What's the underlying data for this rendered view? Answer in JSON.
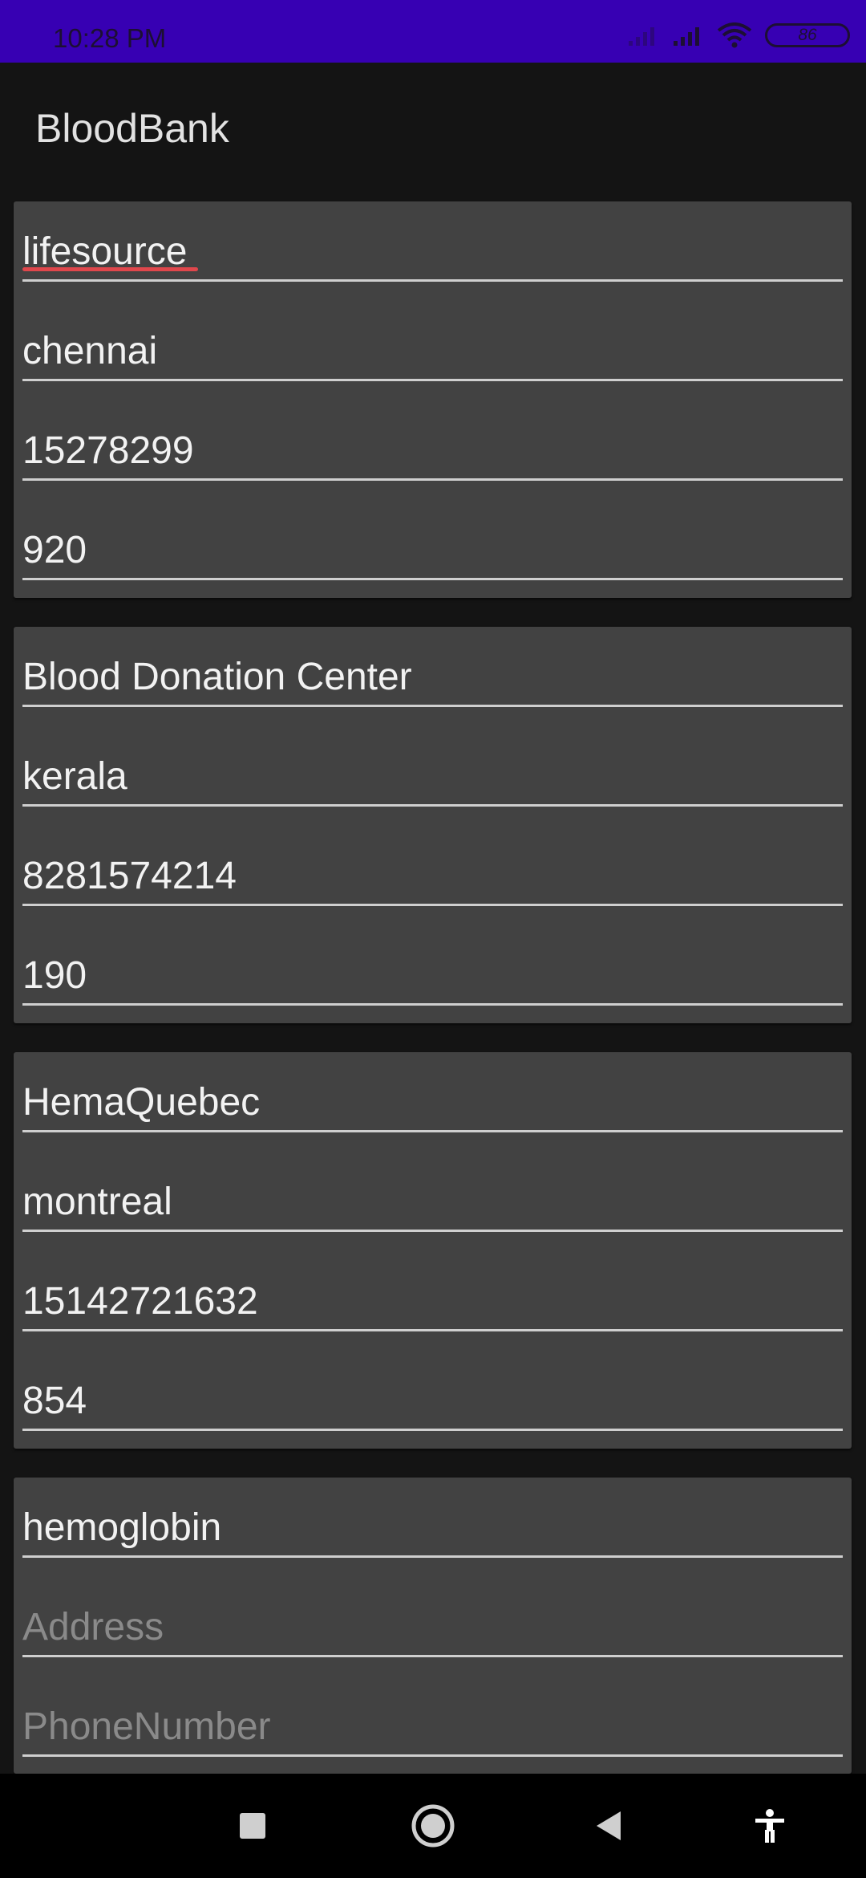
{
  "status_bar": {
    "time": "10:28 PM",
    "battery": "86",
    "icons": [
      "signal-weak-icon",
      "signal-icon",
      "wifi-icon",
      "battery-icon"
    ]
  },
  "app_bar": {
    "title": "BloodBank"
  },
  "colors": {
    "status_bar": "#3700b3",
    "background": "#141414",
    "card": "#424242",
    "text": "#f2f2f2",
    "hint": "#8a8a8a",
    "spell_underline": "#e0474c"
  },
  "cards": [
    {
      "name": "lifesource",
      "address": "chennai",
      "phone": "15278299",
      "units": "920"
    },
    {
      "name": "Blood Donation Center",
      "address": "kerala",
      "phone": "8281574214",
      "units": "190"
    },
    {
      "name": "HemaQuebec",
      "address": "montreal",
      "phone": "15142721632",
      "units": "854"
    },
    {
      "name": "hemoglobin",
      "address_placeholder": "Address",
      "phone_placeholder": "PhoneNumber"
    }
  ],
  "nav_bar": {
    "icons": [
      "recents-square-icon",
      "home-circle-icon",
      "back-triangle-icon",
      "accessibility-icon"
    ]
  }
}
